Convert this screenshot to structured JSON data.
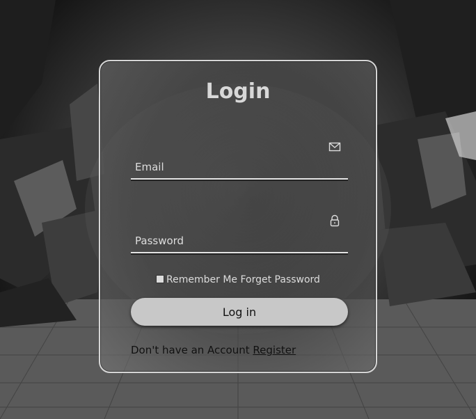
{
  "login": {
    "title": "Login",
    "email": {
      "placeholder": "Email",
      "value": "",
      "icon": "mail-icon"
    },
    "password": {
      "placeholder": "Password",
      "value": "",
      "icon": "lock-icon"
    },
    "remember_label": "Remember Me",
    "forgot_label": "Forget Password",
    "remember_checked": false,
    "submit_label": "Log in",
    "register_prompt": "Don't have an Account",
    "register_link": "Register"
  },
  "colors": {
    "card_border": "#d6d6d6",
    "button_bg": "#c8c8c8",
    "text_light": "#dcdcdc",
    "text_dark": "#111111"
  }
}
